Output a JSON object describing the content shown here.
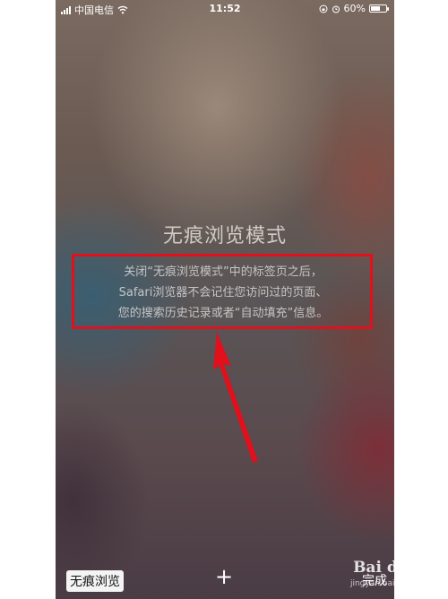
{
  "status_bar": {
    "carrier": "中国电信",
    "time": "11:52",
    "battery_percent": "60%",
    "battery_level": 0.6
  },
  "private_mode": {
    "title": "无痕浏览模式",
    "description_lines": [
      "关闭“无痕浏览模式”中的标签页之后，",
      "Safari浏览器不会记住您访问过的页面、",
      "您的搜索历史记录或者“自动填充”信息。"
    ]
  },
  "toolbar": {
    "private_label": "无痕浏览",
    "add_label": "+",
    "done_label": "完成"
  },
  "watermark": {
    "text": "Bai du 经验",
    "sub": "jingyan.baidu.com"
  },
  "colors": {
    "highlight_box": "#e0101c",
    "arrow": "#e0101c"
  },
  "icons": [
    "signal-icon",
    "wifi-icon",
    "rotation-lock-icon",
    "alarm-icon",
    "battery-icon",
    "add-icon",
    "arrow-annotation"
  ]
}
